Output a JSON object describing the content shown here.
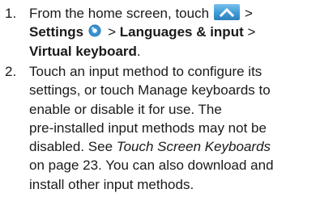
{
  "steps": [
    {
      "number": "1.",
      "text_before_icon": "From the home screen, touch",
      "separator_1": ">",
      "settings_label": "Settings",
      "separator_2": ">",
      "languages_label": "Languages & input",
      "separator_3": ">",
      "virtual_keyboard_label": "Virtual keyboard",
      "end_period": "."
    },
    {
      "number": "2.",
      "lines": [
        "Touch an input method to configure its",
        "settings, or touch Manage keyboards to",
        "enable or disable it for use. The",
        "pre-installed input methods may not be"
      ],
      "line5_prefix": "disabled. See",
      "line5_link": "Touch Screen Keyboards",
      "line6": "on page 23. You can also download and",
      "line7": "install other input methods."
    }
  ],
  "icons": {
    "apps": "apps-icon",
    "settings": "settings-icon"
  },
  "colors": {
    "apps_icon_top": "#79c1ec",
    "apps_icon_bottom": "#2c7fbc",
    "settings_icon": "#3a93d2",
    "text": "#1a1a1a"
  }
}
